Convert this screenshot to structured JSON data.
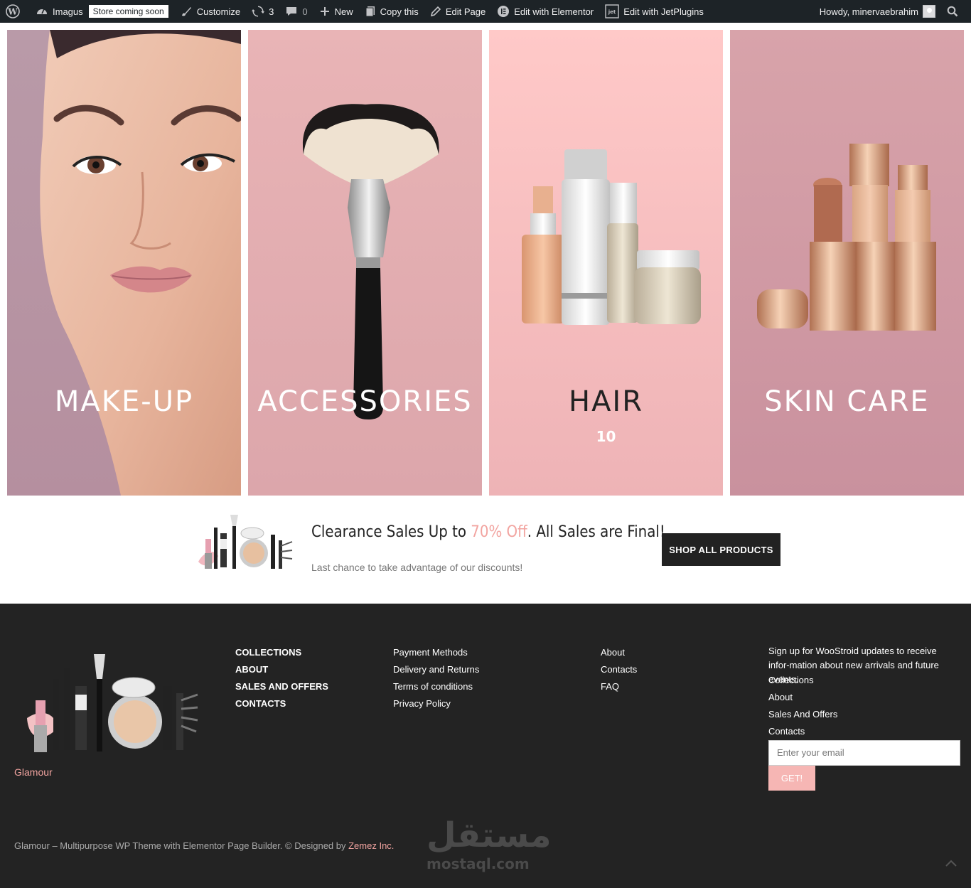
{
  "adminbar": {
    "site_name": "Imagus",
    "store_badge": "Store coming soon",
    "customize": "Customize",
    "updates": "3",
    "comments": "0",
    "new": "New",
    "copy": "Copy this",
    "edit_page": "Edit Page",
    "elementor": "Edit with Elementor",
    "jetplugins": "Edit with JetPlugins",
    "howdy": "Howdy, minervaebrahim"
  },
  "categories": [
    {
      "title": "MAKE-UP"
    },
    {
      "title": "ACCESSORIES"
    },
    {
      "title": "HAIR",
      "count": "10"
    },
    {
      "title": "SKIN CARE"
    }
  ],
  "promo": {
    "headline_pre": "Clearance Sales Up to ",
    "headline_highlight": "70% Off",
    "headline_post": ". All Sales are Final!",
    "subtext": "Last chance to take advantage of our discounts!",
    "button": "SHOP ALL PRODUCTS"
  },
  "footer": {
    "brand": "Glamour",
    "col1": [
      "COLLECTIONS",
      "ABOUT",
      "SALES AND OFFERS",
      "CONTACTS"
    ],
    "col2": [
      "Payment Methods",
      "Delivery and Returns",
      "Terms of conditions",
      "Privacy Policy"
    ],
    "col3": [
      "About",
      "Contacts",
      "FAQ"
    ],
    "signup_text": "Sign up for WooStroid updates to receive infor-mation about new arrivals and future events.",
    "signup_links": [
      "Collections",
      "About",
      "Sales And Offers",
      "Contacts"
    ],
    "email_placeholder": "Enter your email",
    "get_button": "GET!",
    "copyright_pre": "Glamour – Multipurpose WP Theme with Elementor Page Builder. © Designed by ",
    "copyright_link": "Zemez Inc.",
    "watermark_ar": "مستقل",
    "watermark_en": "mostaql.com"
  },
  "colors": {
    "adminbar_bg": "#1d2327",
    "accent_pink": "#f2a4a0",
    "footer_bg": "#232323",
    "button_dark": "#222222",
    "get_button": "#f6b6b4"
  }
}
